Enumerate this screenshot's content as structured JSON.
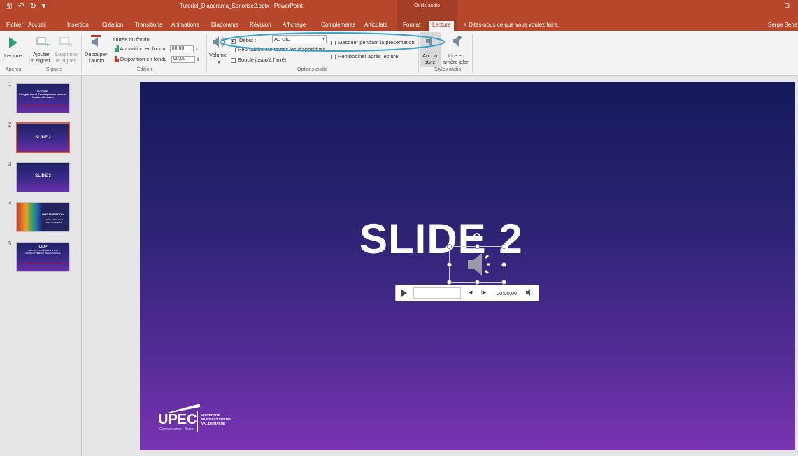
{
  "titlebar": {
    "title": "Tutoriel_Diaporama_Sonorise2.pptx - PowerPoint",
    "context_label": "Outils audio",
    "qat_save": "🖫",
    "qat_undo": "↶",
    "qat_redo": "↻",
    "qat_more": "▾"
  },
  "tabs": {
    "fichier": "Fichier",
    "accueil": "Accueil",
    "insertion": "Insertion",
    "creation": "Création",
    "transitions": "Transitions",
    "animations": "Animations",
    "diaporama": "Diaporama",
    "revision": "Révision",
    "affichage": "Affichage",
    "complements": "Compléments",
    "articulate": "Articulate",
    "format": "Format",
    "lecture": "Lecture",
    "tell_me": "Dites-nous ce que vous voulez faire.",
    "user": "Serge Bena"
  },
  "ribbon": {
    "apercu": {
      "lecture": "Lecture",
      "group": "Aperçu"
    },
    "signets": {
      "ajouter_1": "Ajouter",
      "ajouter_2": "un signet",
      "supprimer_1": "Supprimer",
      "supprimer_2": "le signet",
      "group": "Signets"
    },
    "edition": {
      "decouper_1": "Découper",
      "decouper_2": "l'audio",
      "duree": "Durée du fondu",
      "apparition_label": "Apparition en fondu :",
      "apparition_value": "00,00",
      "disparition_label": "Disparition en fondu :",
      "disparition_value": "00,00",
      "group": "Édition"
    },
    "options": {
      "volume": "Volume",
      "debut_label": "Début :",
      "debut_value": "Au clic",
      "reproduire": "Reproduire sur toutes les diapositives",
      "boucle": "Boucle jusqu'à l'arrêt",
      "masquer": "Masquer pendant la présentation",
      "rembobiner": "Rembobiner après lecture",
      "group": "Options audio"
    },
    "styles": {
      "aucun_1": "Aucun",
      "aucun_2": "style",
      "lire_1": "Lire en",
      "lire_2": "arrière-plan",
      "group": "Styles audio"
    }
  },
  "slides": [
    {
      "num": "1",
      "title": "TUTORIEL",
      "subtitle": "Enregistrement d'un diaporama sonorisé",
      "sub2": "Version alternative"
    },
    {
      "num": "2",
      "title": "SLIDE 2"
    },
    {
      "num": "3",
      "title": "SLIDE 3"
    },
    {
      "num": "4",
      "title": "ORGANISATION",
      "subtitle": "MÉTHODOLOGIE",
      "sub2": "FONCTIONNELLE"
    },
    {
      "num": "5",
      "title": "CIDP",
      "subtitle": "CENTRE D'INGÉNIERIE ET DE",
      "sub2": "DÉVELOPPEMENT PÉDAGOGIQUE"
    }
  ],
  "slide": {
    "title": "SLIDE 2",
    "player_time": "00:00,00",
    "logo": {
      "main": "UPEC",
      "tagline": "Connaissance - Action",
      "univ_1": "UNIVERSITÉ",
      "univ_2": "PARIS-EST CRÉTEIL",
      "univ_3": "VAL DE MARNE"
    }
  },
  "colors": {
    "accent": "#b7472a",
    "highlight_ellipse": "#3aa3c8",
    "slide_top": "#15195a",
    "slide_bottom": "#7a34b2"
  }
}
